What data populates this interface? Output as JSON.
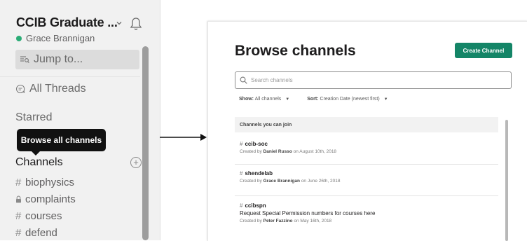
{
  "sidebar": {
    "workspace_name": "CCIB Graduate ...",
    "user_name": "Grace Brannigan",
    "jump_to": "Jump to...",
    "all_threads": "All Threads",
    "starred": "Starred",
    "tooltip": "Browse all channels",
    "channels_header": "Channels",
    "channels": [
      {
        "prefix": "#",
        "name": "biophysics",
        "private": false
      },
      {
        "prefix": "lock",
        "name": "complaints",
        "private": true
      },
      {
        "prefix": "#",
        "name": "courses",
        "private": false
      },
      {
        "prefix": "#",
        "name": "defend",
        "private": false
      }
    ],
    "icons": {
      "bell": "bell-icon",
      "chevron": "chevron-down-icon",
      "add": "plus-circle-icon"
    },
    "colors": {
      "presence": "#2bac76",
      "tooltip_bg": "#111111"
    }
  },
  "panel": {
    "title": "Browse channels",
    "create_button": "Create Channel",
    "search_placeholder": "Search channels",
    "filters": {
      "show_label": "Show:",
      "show_value": "All channels",
      "sort_label": "Sort:",
      "sort_value": "Creation Date (newest first)"
    },
    "section_header": "Channels you can join",
    "channels": [
      {
        "name": "ccib-soc",
        "description": "",
        "created_prefix": "Created by",
        "creator": "Daniel Russo",
        "created_suffix": "on August 10th, 2018"
      },
      {
        "name": "shendelab",
        "description": "",
        "created_prefix": "Created by",
        "creator": "Grace Brannigan",
        "created_suffix": "on June 26th, 2018"
      },
      {
        "name": "ccibspn",
        "description": "Request Special Permission numbers for courses here",
        "created_prefix": "Created by",
        "creator": "Peter Fazzino",
        "created_suffix": "on May 16th, 2018"
      }
    ],
    "colors": {
      "create_button": "#148567"
    }
  }
}
